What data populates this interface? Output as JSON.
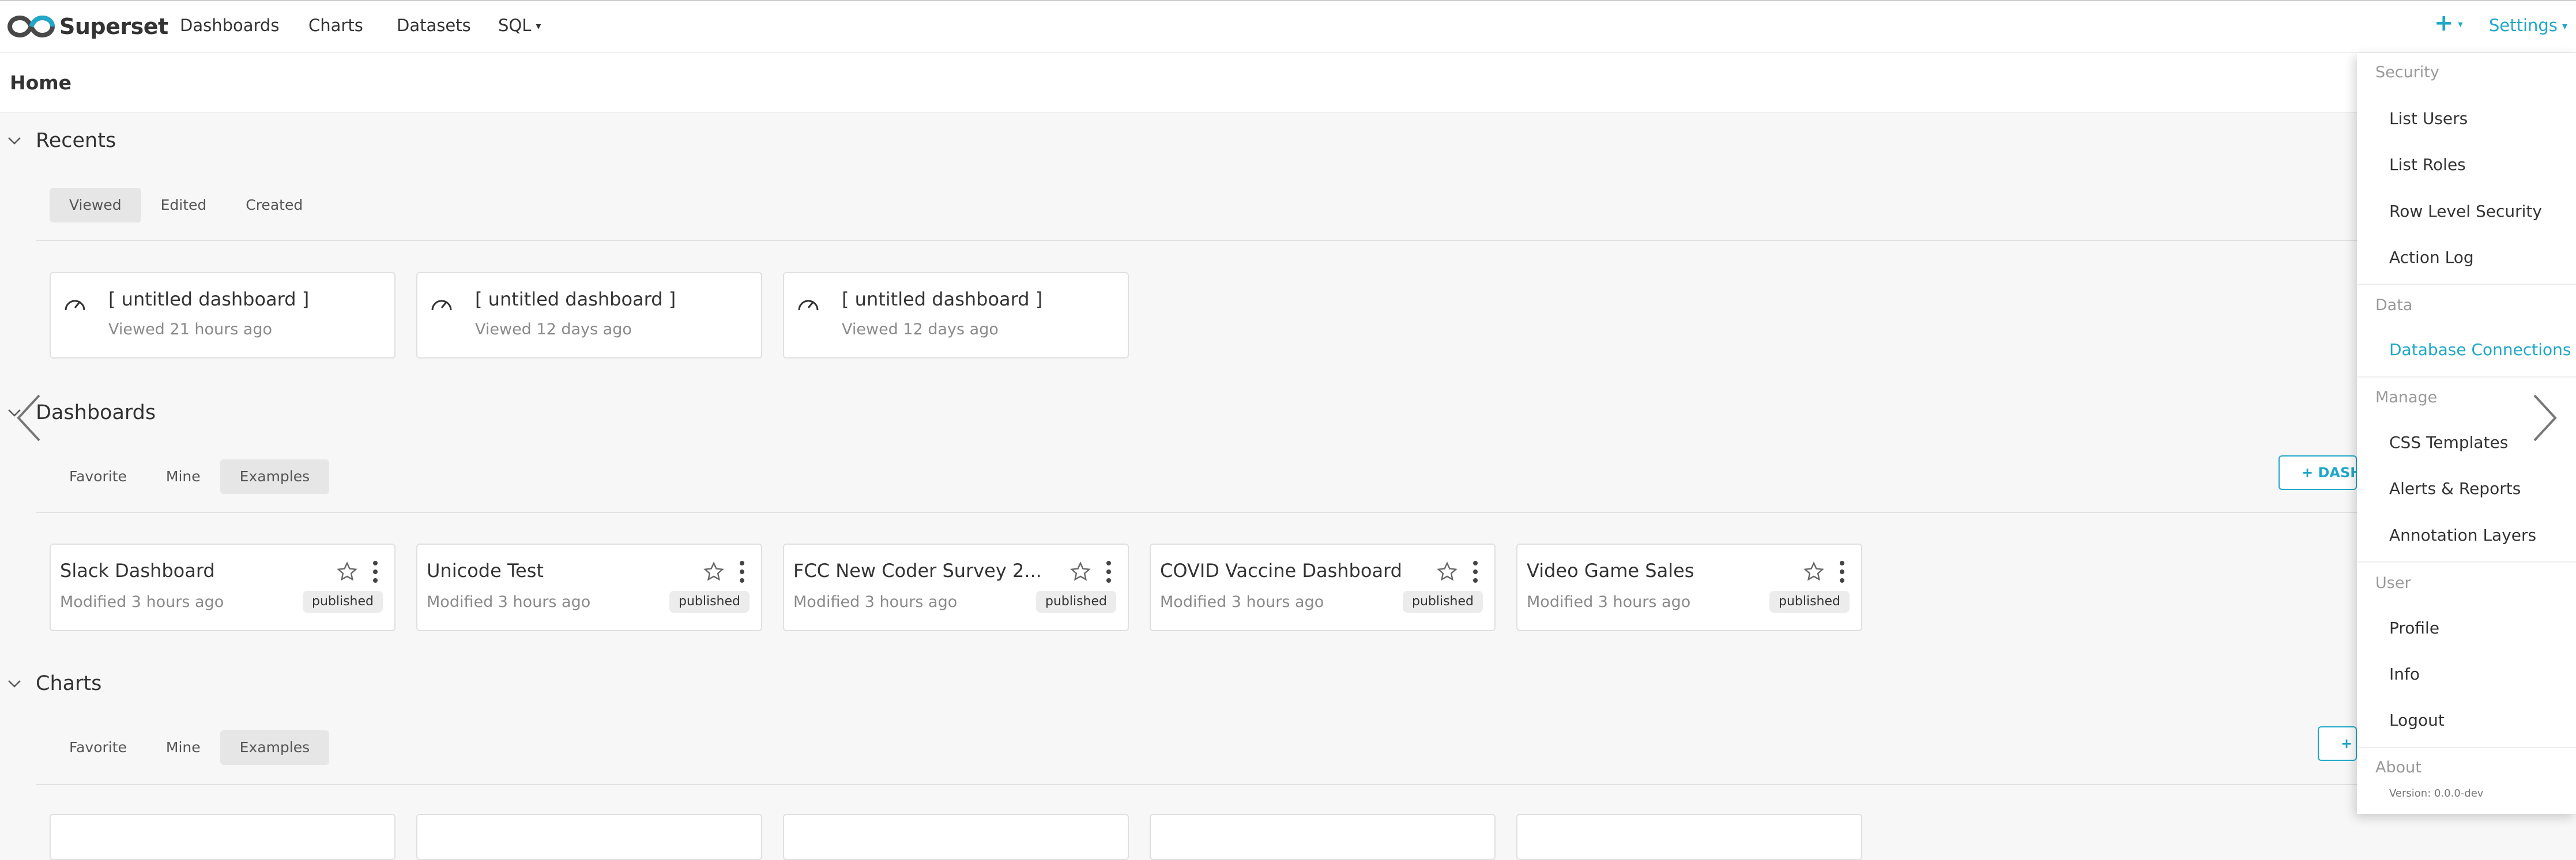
{
  "nav": {
    "brand": "Superset",
    "links": [
      "Dashboards",
      "Charts",
      "Datasets",
      "SQL"
    ],
    "plus": "+",
    "settings": "Settings"
  },
  "header": {
    "title": "Home"
  },
  "recents": {
    "title": "Recents",
    "tabs": [
      "Viewed",
      "Edited",
      "Created"
    ],
    "cards": [
      {
        "title": "[ untitled dashboard ]",
        "subtitle": "Viewed 21 hours ago"
      },
      {
        "title": "[ untitled dashboard ]",
        "subtitle": "Viewed 12 days ago"
      },
      {
        "title": "[ untitled dashboard ]",
        "subtitle": "Viewed 12 days ago"
      }
    ]
  },
  "dashboards": {
    "title": "Dashboards",
    "tabs": [
      "Favorite",
      "Mine",
      "Examples"
    ],
    "action": "+ DASH",
    "cards": [
      {
        "title": "Slack Dashboard",
        "modified": "Modified 3 hours ago",
        "status": "published"
      },
      {
        "title": "Unicode Test",
        "modified": "Modified 3 hours ago",
        "status": "published"
      },
      {
        "title": "FCC New Coder Survey 2...",
        "modified": "Modified 3 hours ago",
        "status": "published"
      },
      {
        "title": "COVID Vaccine Dashboard",
        "modified": "Modified 3 hours ago",
        "status": "published"
      },
      {
        "title": "Video Game Sales",
        "modified": "Modified 3 hours ago",
        "status": "published"
      }
    ]
  },
  "charts": {
    "title": "Charts",
    "tabs": [
      "Favorite",
      "Mine",
      "Examples"
    ],
    "action": "+"
  },
  "settings_menu": {
    "security": {
      "label": "Security",
      "items": [
        "List Users",
        "List Roles",
        "Row Level Security",
        "Action Log"
      ]
    },
    "data": {
      "label": "Data",
      "items": [
        "Database Connections"
      ]
    },
    "manage": {
      "label": "Manage",
      "items": [
        "CSS Templates",
        "Alerts & Reports",
        "Annotation Layers"
      ]
    },
    "user": {
      "label": "User",
      "items": [
        "Profile",
        "Info",
        "Logout"
      ]
    },
    "about": {
      "label": "About",
      "version": "Version: 0.0.0-dev"
    }
  },
  "colors": {
    "accent": "#20a7c9",
    "text": "#333333",
    "muted": "#8a8a8a",
    "background": "#f7f7f7"
  }
}
